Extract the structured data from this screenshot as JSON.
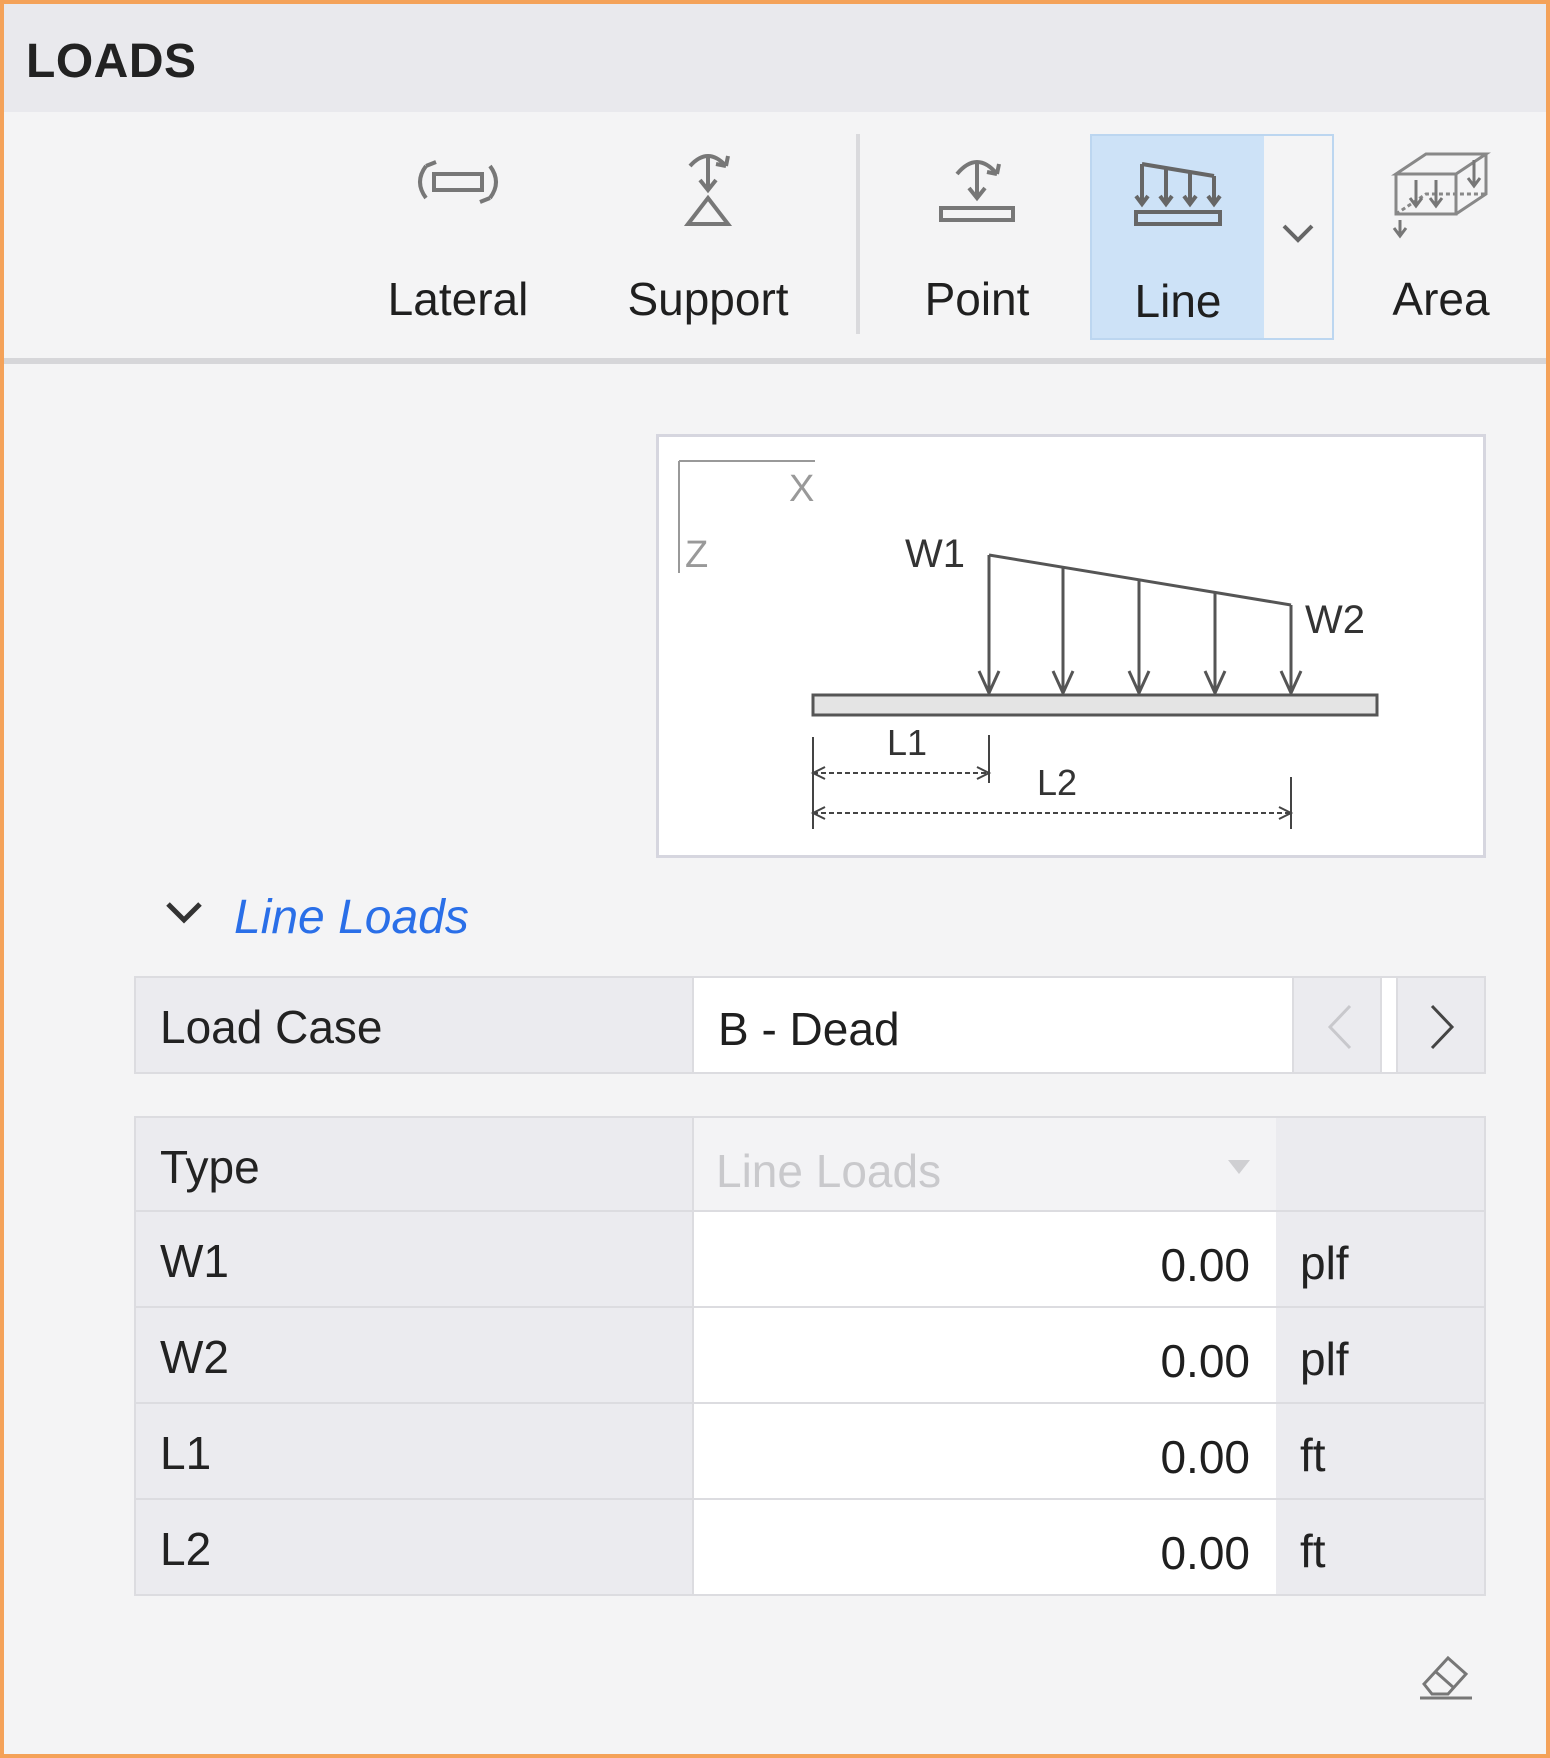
{
  "panel": {
    "title": "LOADS"
  },
  "ribbon": {
    "lateral": "Lateral",
    "support": "Support",
    "point": "Point",
    "line": "Line",
    "area": "Area"
  },
  "diagram": {
    "axis_x": "X",
    "axis_z": "Z",
    "w1": "W1",
    "w2": "W2",
    "l1": "L1",
    "l2": "L2"
  },
  "section": {
    "title": "Line Loads"
  },
  "load_case": {
    "label": "Load Case",
    "value": "B - Dead"
  },
  "rows": [
    {
      "name": "Type",
      "value": "Line Loads",
      "unit": ""
    },
    {
      "name": "W1",
      "value": "0.00",
      "unit": "plf"
    },
    {
      "name": "W2",
      "value": "0.00",
      "unit": "plf"
    },
    {
      "name": "L1",
      "value": "0.00",
      "unit": "ft"
    },
    {
      "name": "L2",
      "value": "0.00",
      "unit": "ft"
    }
  ],
  "colors": {
    "accent": "#2a6fe8",
    "selected": "#cde2f7",
    "frame": "#f4a259"
  }
}
